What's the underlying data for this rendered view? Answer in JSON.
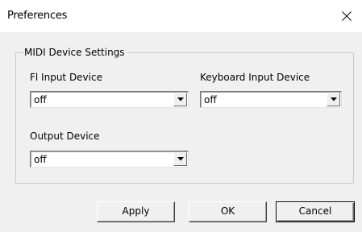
{
  "window": {
    "title": "Preferences",
    "close_icon": "close-icon"
  },
  "group": {
    "title": "MIDI Device Settings"
  },
  "fields": {
    "fl_input": {
      "label": "Fl Input Device",
      "value": "off"
    },
    "keyboard_input": {
      "label": "Keyboard Input Device",
      "value": "off"
    },
    "output": {
      "label": "Output Device",
      "value": "off"
    }
  },
  "buttons": {
    "apply": "Apply",
    "ok": "OK",
    "cancel": "Cancel"
  }
}
